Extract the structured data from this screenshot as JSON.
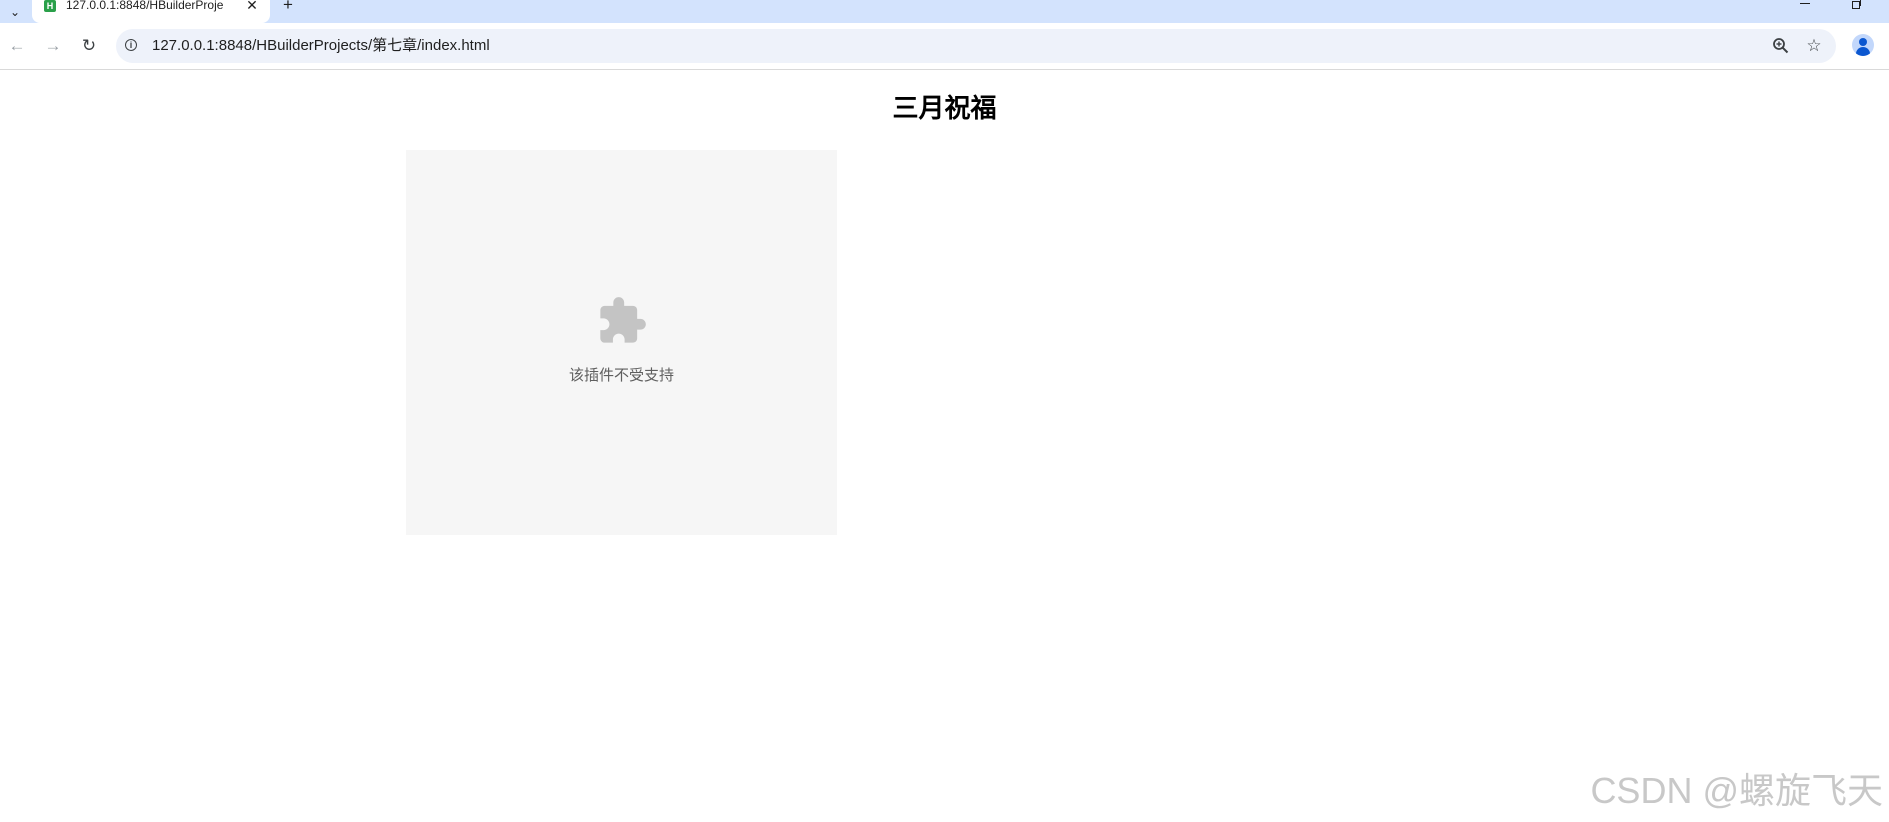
{
  "tab": {
    "favicon_letter": "H",
    "title": "127.0.0.1:8848/HBuilderProje",
    "close_glyph": "✕"
  },
  "tabstrip": {
    "new_tab_glyph": "+",
    "tab_search_glyph": "⌄"
  },
  "toolbar": {
    "back_glyph": "←",
    "forward_glyph": "→",
    "reload_glyph": "↻",
    "site_info_glyph": "i",
    "url": "127.0.0.1:8848/HBuilderProjects/第七章/index.html",
    "star_glyph": "☆"
  },
  "icons": {
    "puzzle_color": "#c4c4c4",
    "accent": "#0b57d0"
  },
  "page": {
    "title": "三月祝福",
    "plugin_message": "该插件不受支持"
  },
  "watermark": "CSDN @螺旋飞天"
}
